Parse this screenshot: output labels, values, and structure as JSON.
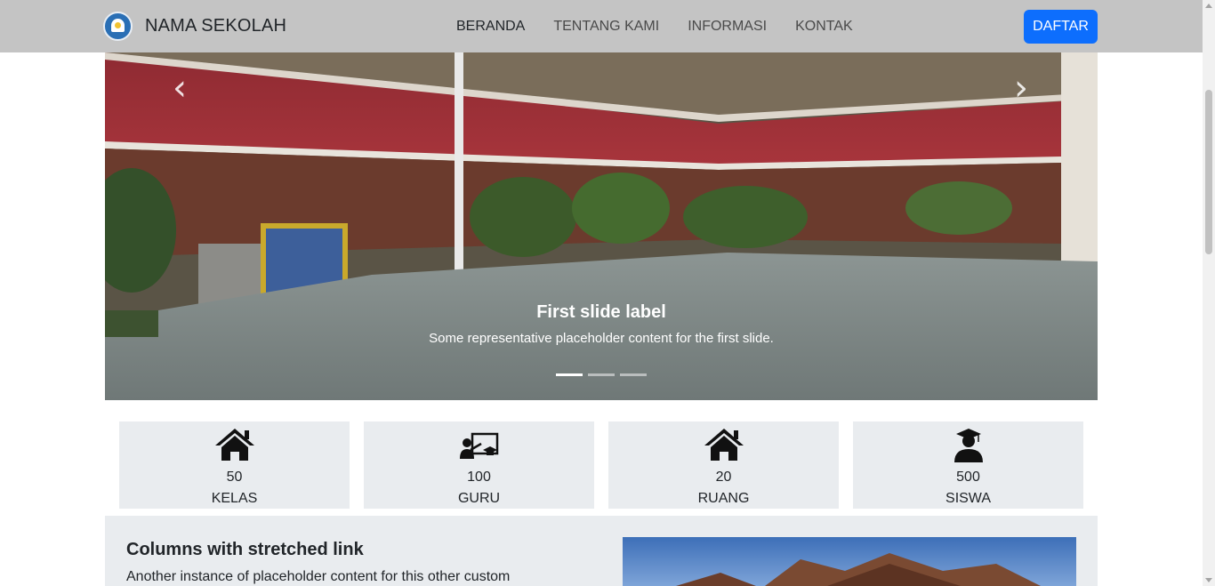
{
  "navbar": {
    "brand_name": "NAMA SEKOLAH",
    "links": [
      "BERANDA",
      "TENTANG KAMI",
      "INFORMASI",
      "KONTAK"
    ],
    "active_link": "BERANDA",
    "cta_label": "DAFTAR",
    "cta_color": "#0d6efd",
    "background": "#c4c4c4"
  },
  "carousel": {
    "prev_icon": "chevron-left-icon",
    "next_icon": "chevron-right-icon",
    "prev_symbol": "‹",
    "next_symbol": "›",
    "caption_title": "First slide label",
    "caption_text": "Some representative placeholder content for the first slide.",
    "slide_count": 3,
    "active_slide": 1
  },
  "stats": [
    {
      "icon": "house-icon",
      "value": "50",
      "label": "KELAS"
    },
    {
      "icon": "teacher-board-icon",
      "value": "100",
      "label": "GURU"
    },
    {
      "icon": "house-icon",
      "value": "20",
      "label": "RUANG"
    },
    {
      "icon": "graduate-student-icon",
      "value": "500",
      "label": "SISWA"
    }
  ],
  "feature": {
    "title": "Columns with stretched link",
    "text": "Another instance of placeholder content for this other custom"
  }
}
